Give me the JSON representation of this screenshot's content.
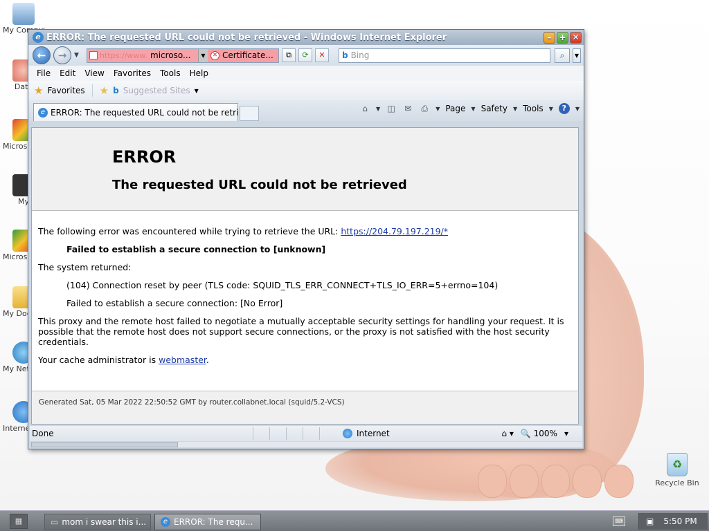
{
  "window": {
    "title": "ERROR: The requested URL could not be retrieved - Windows Internet Explorer"
  },
  "address": {
    "blurred_text": "https://www.",
    "host": "microso...",
    "cert_error": "Certificate..."
  },
  "search": {
    "placeholder": "Bing"
  },
  "menu": [
    "File",
    "Edit",
    "View",
    "Favorites",
    "Tools",
    "Help"
  ],
  "favorites": {
    "label": "Favorites",
    "suggested": "Suggested Sites"
  },
  "tab": {
    "title": "ERROR: The requested URL could not be retri..."
  },
  "command_bar": {
    "page": "Page",
    "safety": "Safety",
    "tools": "Tools"
  },
  "page": {
    "h1": "ERROR",
    "h2": "The requested URL could not be retrieved",
    "intro": "The following error was encountered while trying to retrieve the URL: ",
    "url": "https://204.79.197.219/*",
    "failed": "Failed to establish a secure connection to [unknown]",
    "system_returned": "The system returned:",
    "reset": "(104) Connection reset by peer (TLS code: SQUID_TLS_ERR_CONNECT+TLS_IO_ERR=5+errno=104)",
    "secure_fail": "Failed to establish a secure connection: [No Error]",
    "explain": "This proxy and the remote host failed to negotiate a mutually acceptable security settings for handling your request. It is possible that the remote host does not support secure connections, or the proxy is not satisfied with the host security credentials.",
    "admin_prefix": "Your cache administrator is ",
    "admin_link": "webmaster",
    "admin_suffix": ".",
    "generated": "Generated Sat, 05 Mar 2022 22:50:52 GMT by router.collabnet.local (squid/5.2-VCS)"
  },
  "status": {
    "done": "Done",
    "zone": "Internet",
    "zoom": "100%"
  },
  "desktop": {
    "icons": [
      "My Computer",
      "Data",
      "Microsoft Visual",
      "My",
      "Microsoft Visual",
      "My Documents",
      "My Network Places",
      "Internet Explorer"
    ],
    "recycle": "Recycle Bin"
  },
  "taskbar": {
    "folder_task": "mom i swear this i...",
    "ie_task": "ERROR: The requ...",
    "clock": "5:50 PM"
  }
}
